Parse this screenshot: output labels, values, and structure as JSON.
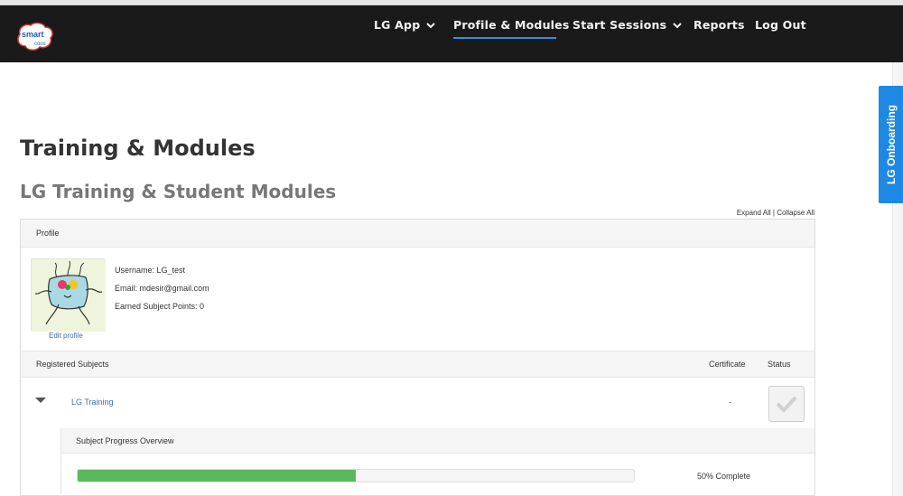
{
  "nav": {
    "logo_text_top": "smart",
    "logo_text_bottom": "coos",
    "items": [
      {
        "label": "LG App",
        "dropdown": true
      },
      {
        "label": "Profile & Modules",
        "dropdown": false,
        "active": true
      },
      {
        "label": "Start Sessions",
        "dropdown": true
      },
      {
        "label": "Reports",
        "dropdown": false
      },
      {
        "label": "Log Out",
        "dropdown": false
      }
    ]
  },
  "side_tab": {
    "label": "LG Onboarding"
  },
  "page": {
    "title": "Training & Modules",
    "subtitle": "LG Training & Student Modules"
  },
  "expand": {
    "expand_all": "Expand All",
    "separator": "|",
    "collapse_all": "Collapse All"
  },
  "profile": {
    "header": "Profile",
    "username_line": "Username: LG_test",
    "email_line": "Email: mdesir@gmail.com",
    "points_line": "Earned Subject Points: 0",
    "edit_link": "Edit profile"
  },
  "subjects": {
    "header": "Registered Subjects",
    "col_certificate": "Certificate",
    "col_status": "Status",
    "rows": [
      {
        "name": "LG Training",
        "certificate": "-",
        "completed": false
      }
    ]
  },
  "progress": {
    "header": "Subject Progress Overview",
    "percent": 50,
    "label": "50% Complete"
  },
  "colors": {
    "nav_bg": "#1a1a1a",
    "accent_blue": "#1e88e5",
    "active_underline": "#2f8fe8",
    "progress_green": "#5cb85c",
    "link_blue": "#3f6ea7"
  }
}
